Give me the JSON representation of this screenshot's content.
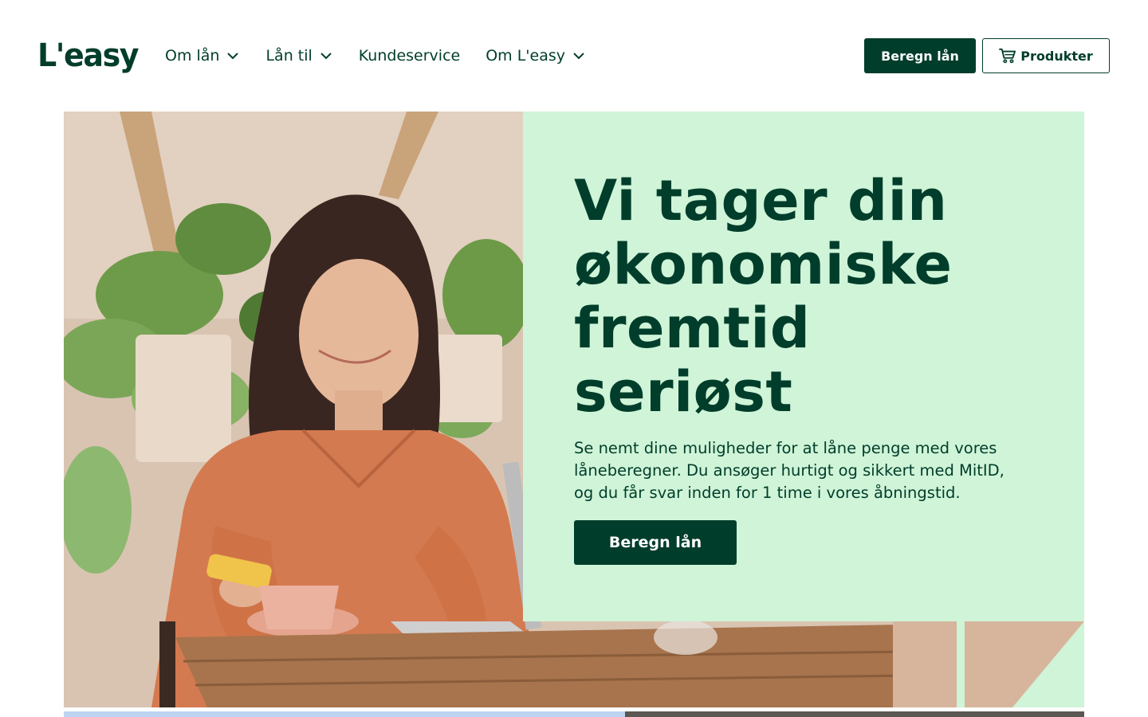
{
  "brand": {
    "logo_text": "L'easy"
  },
  "nav": {
    "items": [
      {
        "label": "Om lån",
        "has_dropdown": true
      },
      {
        "label": "Lån til",
        "has_dropdown": true
      },
      {
        "label": "Kundeservice",
        "has_dropdown": false
      },
      {
        "label": "Om L'easy",
        "has_dropdown": true
      }
    ]
  },
  "header_actions": {
    "calculate_label": "Beregn lån",
    "products_label": "Produkter",
    "products_icon": "cart-icon"
  },
  "hero": {
    "headline_lines": [
      "Vi tager din",
      "økonomiske",
      "fremtid",
      "seriøst"
    ],
    "subtext": "Se nemt dine muligheder for at låne penge med vores låneberegner. Du ansøger hurtigt og sikkert med MitID, og du får svar inden for 1 time i vores åbningstid.",
    "cta_label": "Beregn lån"
  },
  "colors": {
    "brand_dark": "#003d2b",
    "panel_mint": "#cff4d7",
    "white": "#ffffff"
  }
}
